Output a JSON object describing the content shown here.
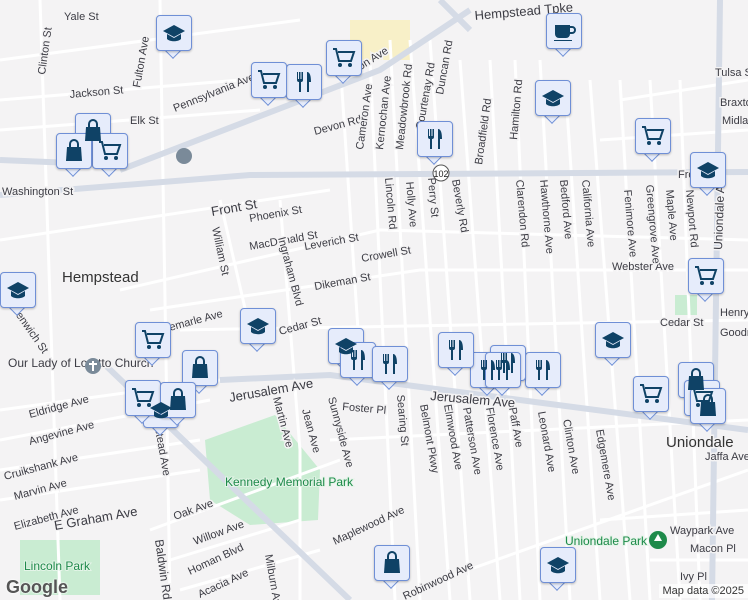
{
  "streets": [
    "Yale St",
    "Clinton St",
    "Jackson St",
    "Elk St",
    "Pennsylvania Ave",
    "Fulton Ave",
    "Devon Rd",
    "Cameron Ave",
    "Kernochan Ave",
    "Meadowbrook Rd",
    "Courtenay Rd",
    "Duncan Rd",
    "Broadfield Rd",
    "Hamilton Rd",
    "Front St",
    "Phoenix St",
    "MacDonald St",
    "Leverich St",
    "Crowell St",
    "Webster Ave",
    "Dikeman St",
    "Cedar St",
    "Cedar St",
    "William St",
    "Ingraham Blvd",
    "Lincoln Rd",
    "Holly Ave",
    "Perry St",
    "Beverly Rd",
    "Clarendon Rd",
    "Hawthorne Ave",
    "Bedford Ave",
    "California Ave",
    "Fenimore Ave",
    "Greengrove Ave",
    "Maple Ave",
    "Newport Rd",
    "Uniondale Ave",
    "Tulsa St",
    "Braxton",
    "Midla",
    "Jerusalem Ave",
    "Jerusalem Ave",
    "Foster Pl",
    "Jean Ave",
    "Martin Ave",
    "Sunnyside Ave",
    "Searing St",
    "Belmont Pkwy",
    "Elmwood Ave",
    "Patterson Ave",
    "Florence Ave",
    "Paff Ave",
    "Leonard Ave",
    "Clinton Ave",
    "Edgemere Ave",
    "Eldridge Ave",
    "Angevine Ave",
    "Cruikshank Ave",
    "Marvin Ave",
    "Elizabeth Ave",
    "E Graham Ave",
    "Oak Ave",
    "Willow Ave",
    "Homan Blvd",
    "Acacia Ave",
    "Milburn Ave",
    "Baldwin Rd",
    "Maplewood Ave",
    "Robinwood Ave",
    "Ivy Pl",
    "Macon Pl",
    "Waypark Ave",
    "Jaffa Ave",
    "Henry",
    "Goodr",
    "Hempstead Ave",
    "Front St",
    "Albemarle Ave",
    "Greenwich St",
    "Washington St",
    "Fulton Ave",
    "Hempstead Tpke"
  ],
  "places": {
    "hempstead": "Hempstead",
    "uniondale": "Uniondale",
    "church": "Our Lady of Loretto Church",
    "kennedy": "Kennedy Memorial Park",
    "lincoln_park": "Lincoln Park",
    "uniondale_park": "Uniondale Park"
  },
  "route_shield": "102",
  "markers": [
    "school",
    "shopping",
    "restaurant",
    "shopping",
    "shopping",
    "school",
    "cafe",
    "school",
    "restaurant",
    "shopping",
    "shopping",
    "shopping",
    "school",
    "shopping",
    "school",
    "shopping",
    "school",
    "school",
    "restaurant",
    "restaurant",
    "restaurant",
    "restaurant",
    "shopping",
    "restaurant",
    "restaurant",
    "restaurant",
    "school",
    "shopping",
    "shopping",
    "shopping",
    "shopping",
    "school",
    "shopping",
    "shopping",
    "shopping"
  ],
  "attribution": {
    "logo": "Google",
    "map_data": "Map data ©2025"
  },
  "colors": {
    "marker_fill": "#e6ecfb",
    "marker_border": "#6f8fd6",
    "icon": "#0f4266",
    "park": "#c9ecd2"
  }
}
